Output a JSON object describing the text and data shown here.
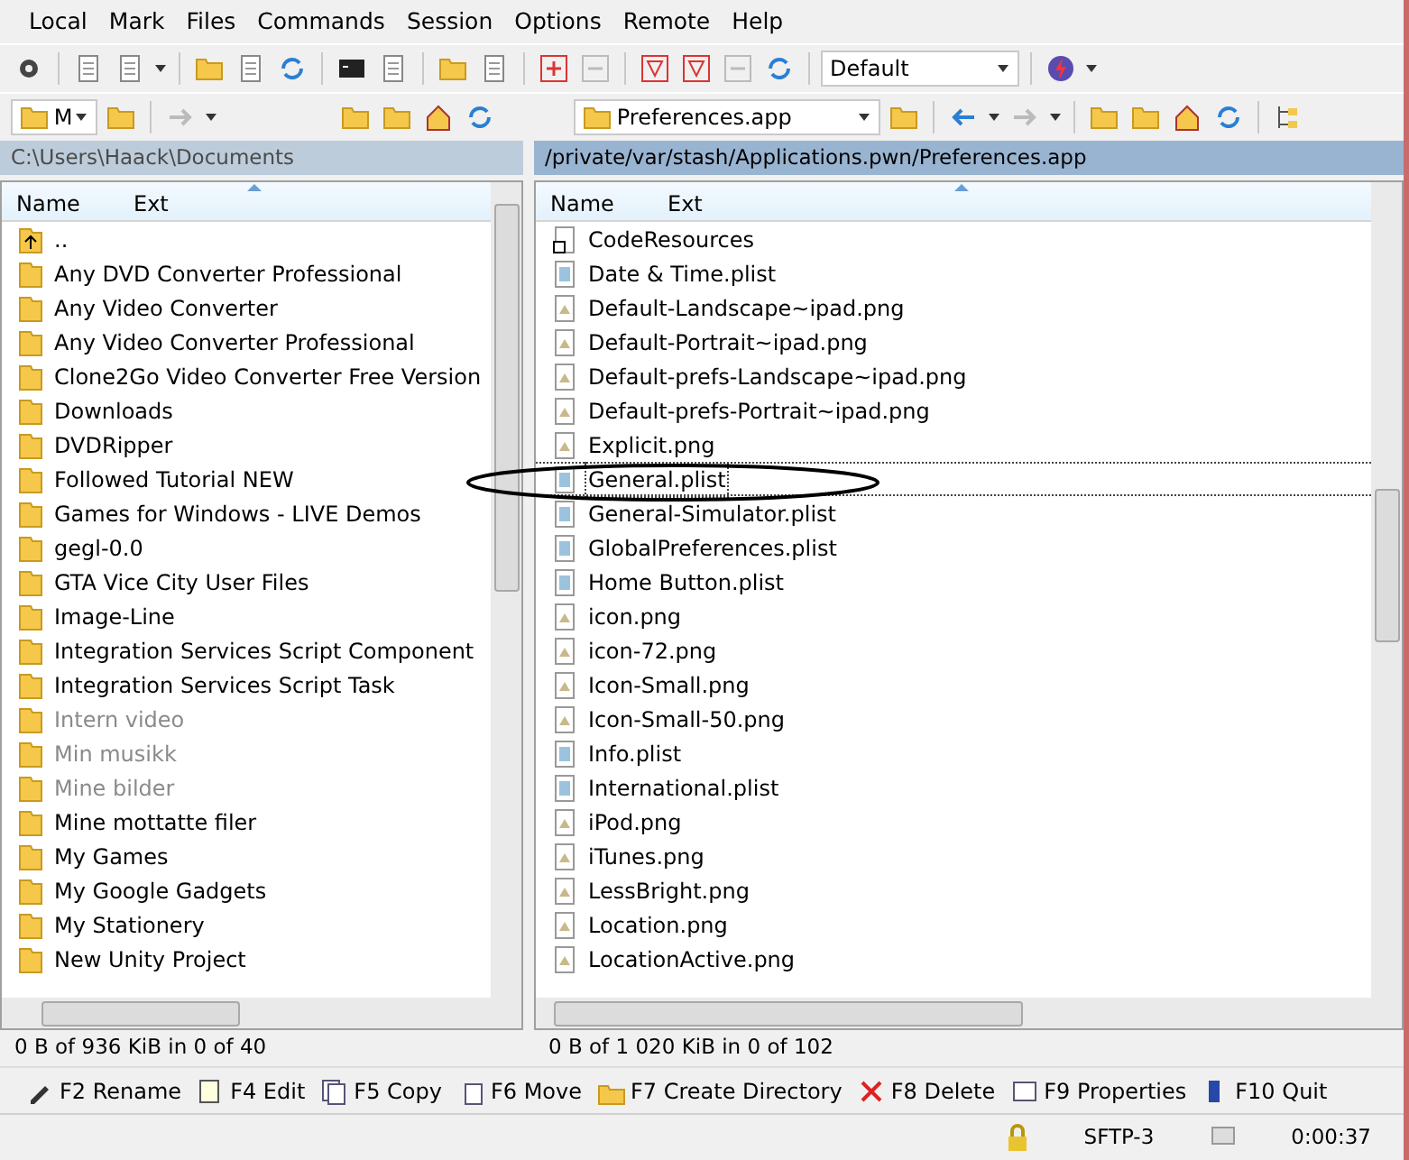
{
  "menu": [
    "Local",
    "Mark",
    "Files",
    "Commands",
    "Session",
    "Options",
    "Remote",
    "Help"
  ],
  "toolbar": {
    "preset": "Default"
  },
  "left_panel": {
    "drive": "M",
    "path": "C:\\Users\\Haack\\Documents",
    "active": false,
    "columns": [
      "Name",
      "Ext"
    ],
    "items": [
      {
        "name": "..",
        "kind": "parent",
        "dimmed": false
      },
      {
        "name": "Any DVD Converter Professional",
        "kind": "folder",
        "dimmed": false
      },
      {
        "name": "Any Video Converter",
        "kind": "folder",
        "dimmed": false
      },
      {
        "name": "Any Video Converter Professional",
        "kind": "folder",
        "dimmed": false
      },
      {
        "name": "Clone2Go Video Converter Free Version",
        "kind": "folder",
        "dimmed": false
      },
      {
        "name": "Downloads",
        "kind": "folder",
        "dimmed": false
      },
      {
        "name": "DVDRipper",
        "kind": "folder",
        "dimmed": false
      },
      {
        "name": "Followed Tutorial NEW",
        "kind": "folder",
        "dimmed": false
      },
      {
        "name": "Games for Windows - LIVE Demos",
        "kind": "folder",
        "dimmed": false
      },
      {
        "name": "gegl-0.0",
        "kind": "folder",
        "dimmed": false
      },
      {
        "name": "GTA Vice City User Files",
        "kind": "folder",
        "dimmed": false
      },
      {
        "name": "Image-Line",
        "kind": "folder",
        "dimmed": false
      },
      {
        "name": "Integration Services Script Component",
        "kind": "folder",
        "dimmed": false
      },
      {
        "name": "Integration Services Script Task",
        "kind": "folder",
        "dimmed": false
      },
      {
        "name": "Intern video",
        "kind": "folder",
        "dimmed": true
      },
      {
        "name": "Min musikk",
        "kind": "folder",
        "dimmed": true
      },
      {
        "name": "Mine bilder",
        "kind": "folder",
        "dimmed": true
      },
      {
        "name": "Mine mottatte filer",
        "kind": "folder",
        "dimmed": false
      },
      {
        "name": "My Games",
        "kind": "folder",
        "dimmed": false
      },
      {
        "name": "My Google Gadgets",
        "kind": "folder",
        "dimmed": false
      },
      {
        "name": "My Stationery",
        "kind": "folder",
        "dimmed": false
      },
      {
        "name": "New Unity Project",
        "kind": "folder",
        "dimmed": false
      }
    ],
    "summary": "0 B of 936 KiB in 0 of 40"
  },
  "right_panel": {
    "drive": "Preferences.app",
    "path": "/private/var/stash/Applications.pwn/Preferences.app",
    "active": true,
    "columns": [
      "Name",
      "Ext"
    ],
    "items": [
      {
        "name": "CodeResources",
        "kind": "link",
        "focused": false
      },
      {
        "name": "Date & Time.plist",
        "kind": "plist",
        "focused": false
      },
      {
        "name": "Default-Landscape~ipad.png",
        "kind": "png",
        "focused": false
      },
      {
        "name": "Default-Portrait~ipad.png",
        "kind": "png",
        "focused": false
      },
      {
        "name": "Default-prefs-Landscape~ipad.png",
        "kind": "png",
        "focused": false
      },
      {
        "name": "Default-prefs-Portrait~ipad.png",
        "kind": "png",
        "focused": false
      },
      {
        "name": "Explicit.png",
        "kind": "png",
        "focused": false
      },
      {
        "name": "General.plist",
        "kind": "plist",
        "focused": true
      },
      {
        "name": "General-Simulator.plist",
        "kind": "plist",
        "focused": false
      },
      {
        "name": "GlobalPreferences.plist",
        "kind": "plist",
        "focused": false
      },
      {
        "name": "Home Button.plist",
        "kind": "plist",
        "focused": false
      },
      {
        "name": "icon.png",
        "kind": "png",
        "focused": false
      },
      {
        "name": "icon-72.png",
        "kind": "png",
        "focused": false
      },
      {
        "name": "Icon-Small.png",
        "kind": "png",
        "focused": false
      },
      {
        "name": "Icon-Small-50.png",
        "kind": "png",
        "focused": false
      },
      {
        "name": "Info.plist",
        "kind": "plist",
        "focused": false
      },
      {
        "name": "International.plist",
        "kind": "plist",
        "focused": false
      },
      {
        "name": "iPod.png",
        "kind": "png",
        "focused": false
      },
      {
        "name": "iTunes.png",
        "kind": "png",
        "focused": false
      },
      {
        "name": "LessBright.png",
        "kind": "png",
        "focused": false
      },
      {
        "name": "Location.png",
        "kind": "png",
        "focused": false
      },
      {
        "name": "LocationActive.png",
        "kind": "png",
        "focused": false
      }
    ],
    "summary": "0 B of 1 020 KiB in 0 of 102"
  },
  "function_keys": [
    "F2 Rename",
    "F4 Edit",
    "F5 Copy",
    "F6 Move",
    "F7 Create Directory",
    "F8 Delete",
    "F9 Properties",
    "F10 Quit"
  ],
  "status_bar": {
    "protocol": "SFTP-3",
    "elapsed": "0:00:37"
  }
}
